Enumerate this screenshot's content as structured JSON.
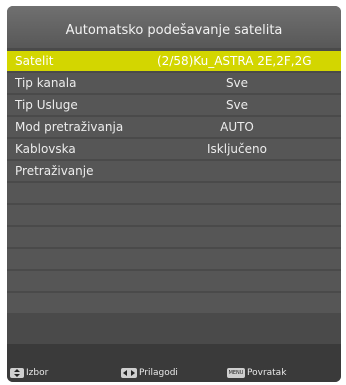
{
  "header": {
    "title": "Automatsko podešavanje satelita"
  },
  "menu": [
    {
      "label": "Satelit",
      "value": "(2/58)Ku_ASTRA 2E,2F,2G",
      "selected": true
    },
    {
      "label": "Tip kanala",
      "value": "Sve"
    },
    {
      "label": "Tip Usluge",
      "value": "Sve"
    },
    {
      "label": "Mod pretraživanja",
      "value": "AUTO"
    },
    {
      "label": "Kablovska",
      "value": "Isključeno"
    },
    {
      "label": "Pretraživanje",
      "value": ""
    }
  ],
  "footer": {
    "select": {
      "icon": "up-down-arrows-icon",
      "label": "Izbor"
    },
    "adjust": {
      "icon": "left-right-arrows-icon",
      "label": "Prilagodi"
    },
    "back": {
      "icon": "menu-key-icon",
      "key": "MENU",
      "label": "Povratak"
    }
  },
  "colors": {
    "highlight": "#d3d600",
    "panel": "#4a4a4a",
    "row": "#565656"
  }
}
